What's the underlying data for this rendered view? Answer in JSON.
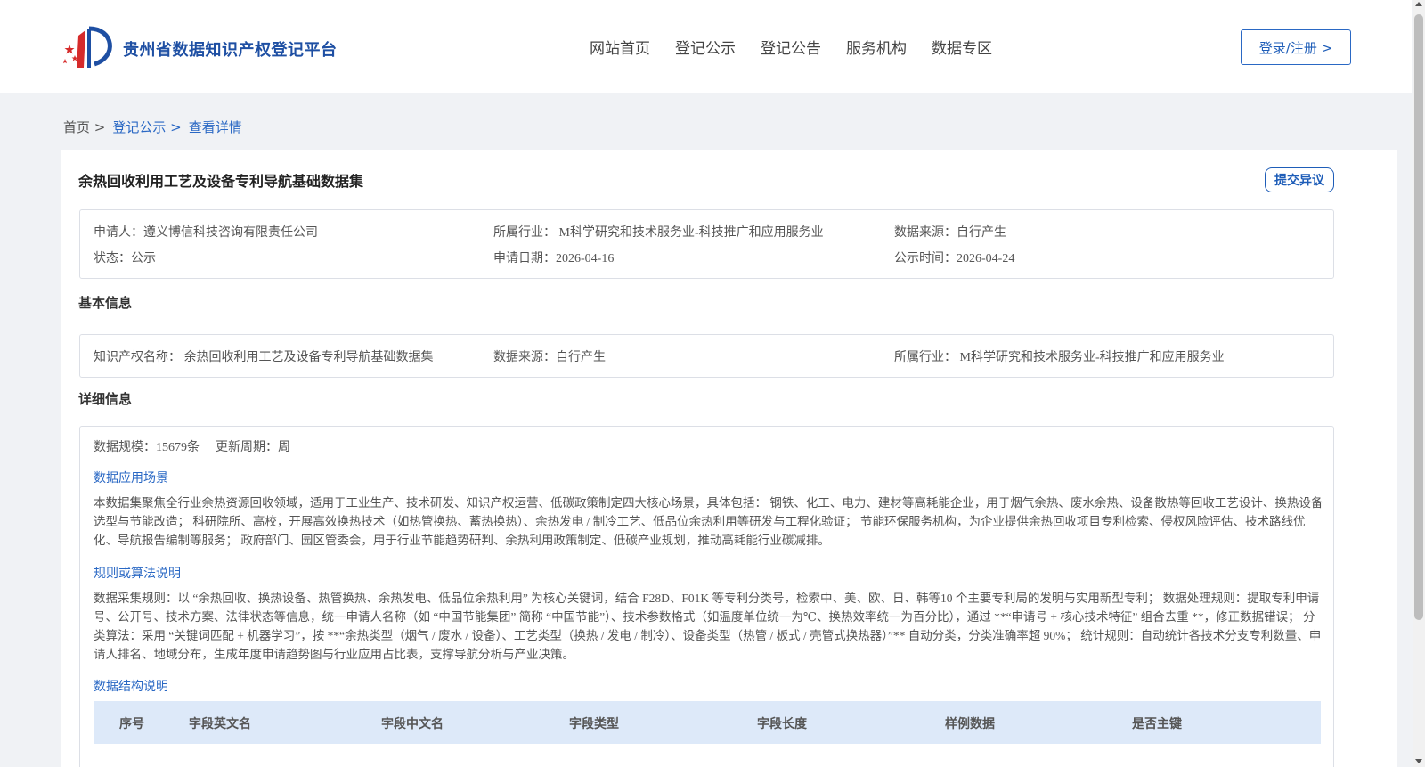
{
  "header": {
    "site_name": "贵州省数据知识产权登记平台",
    "nav": [
      "网站首页",
      "登记公示",
      "登记公告",
      "服务机构",
      "数据专区"
    ],
    "login_label": "登录/注册 >"
  },
  "breadcrumb": {
    "home": "首页 >",
    "level2": "登记公示 >",
    "current": "查看详情"
  },
  "record": {
    "title": "余热回收利用工艺及设备专利导航基础数据集",
    "objection_label": "提交异议",
    "applicant": "申请人：遵义博信科技咨询有限责任公司",
    "industry": "所属行业： M科学研究和技术服务业-科技推广和应用服务业",
    "source": "数据来源：自行产生",
    "status": "状态：公示",
    "apply_date": "申请日期：2026-04-16",
    "publish_date": "公示时间：2026-04-24"
  },
  "basic": {
    "section_title": "基本信息",
    "ip_name": "知识产权名称： 余热回收利用工艺及设备专利导航基础数据集",
    "source": "数据来源：自行产生",
    "industry": "所属行业： M科学研究和技术服务业-科技推广和应用服务业"
  },
  "detail": {
    "section_title": "详细信息",
    "scale": "数据规模：15679条",
    "cycle": "更新周期：周",
    "scenario_heading": "数据应用场景",
    "scenario_text": "本数据集聚焦全行业余热资源回收领域，适用于工业生产、技术研发、知识产权运营、低碳政策制定四大核心场景，具体包括： 钢铁、化工、电力、建材等高耗能企业，用于烟气余热、废水余热、设备散热等回收工艺设计、换热设备选型与节能改造； 科研院所、高校，开展高效换热技术（如热管换热、蓄热换热）、余热发电 / 制冷工艺、低品位余热利用等研发与工程化验证； 节能环保服务机构，为企业提供余热回收项目专利检索、侵权风险评估、技术路线优化、导航报告编制等服务； 政府部门、园区管委会，用于行业节能趋势研判、余热利用政策制定、低碳产业规划，推动高耗能行业碳减排。",
    "rules_heading": "规则或算法说明",
    "rules_text": "数据采集规则：以 “余热回收、换热设备、热管换热、余热发电、低品位余热利用” 为核心关键词，结合 F28D、F01K 等专利分类号，检索中、美、欧、日、韩等10 个主要专利局的发明与实用新型专利； 数据处理规则：提取专利申请号、公开号、技术方案、法律状态等信息，统一申请人名称（如 “中国节能集团” 简称 “中国节能”）、技术参数格式（如温度单位统一为℃、换热效率统一为百分比），通过 **“申请号 + 核心技术特征” 组合去重 **，修正数据错误； 分类算法：采用 “关键词匹配 + 机器学习”，按 **“余热类型（烟气 / 废水 / 设备）、工艺类型（换热 / 发电 / 制冷）、设备类型（热管 / 板式 / 壳管式换热器）”** 自动分类，分类准确率超 90%； 统计规则：自动统计各技术分支专利数量、申请人排名、地域分布，生成年度申请趋势图与行业应用占比表，支撑导航分析与产业决策。",
    "structure_heading": "数据结构说明",
    "table_headers": [
      "序号",
      "字段英文名",
      "字段中文名",
      "字段类型",
      "字段长度",
      "样例数据",
      "是否主键"
    ]
  },
  "colors": {
    "brand": "#1e4fa3",
    "link": "#2a68c4",
    "table_header_bg": "#dde9f9",
    "page_bg": "#f0f2f5"
  }
}
